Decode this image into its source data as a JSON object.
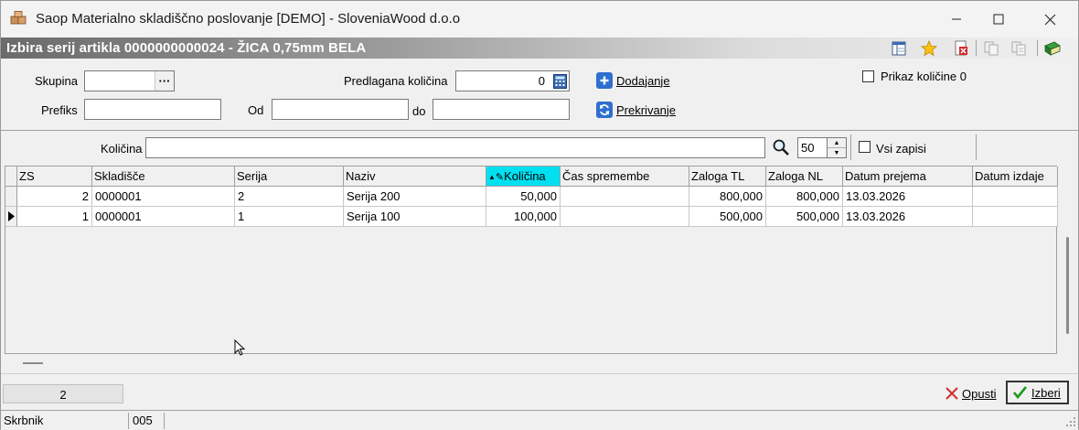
{
  "window": {
    "title": "Saop Materialno skladiščno poslovanje [DEMO] - SloveniaWood d.o.o"
  },
  "header": {
    "title": "Izbira serij artikla 0000000000024 - ŽICA 0,75mm BELA"
  },
  "filters": {
    "skupina_label": "Skupina",
    "skupina_value": "",
    "dots_label": "···",
    "prefiks_label": "Prefiks",
    "prefiks_value": "",
    "od_label": "Od",
    "od_value": "",
    "do_label": "do",
    "do_value": "",
    "predlagana_label": "Predlagana količina",
    "predlagana_value": "0",
    "dodajanje_label": "Dodajanje",
    "prekrivanje_label": "Prekrivanje",
    "prikaz_label": "Prikaz količine 0",
    "prikaz_checked": false,
    "kolicina_label": "Količina",
    "kolicina_value": "",
    "limit_value": "50",
    "vsi_label": "Vsi zapisi",
    "vsi_checked": false
  },
  "grid": {
    "columns": [
      "ZS",
      "Skladišče",
      "Serija",
      "Naziv",
      "Količina",
      "Čas spremembe",
      "Zaloga TL",
      "Zaloga NL",
      "Datum prejema",
      "Datum izdaje"
    ],
    "sorted_column": "Količina",
    "rows": [
      {
        "zs": "2",
        "skladisce": "0000001",
        "serija": "2",
        "naziv": "Serija 200",
        "kolicina": "50,000",
        "cas": "",
        "zaloga_tl": "800,000",
        "zaloga_nl": "800,000",
        "datum_prejema": "13.03.2026",
        "datum_izdaje": "",
        "current": false
      },
      {
        "zs": "1",
        "skladisce": "0000001",
        "serija": "1",
        "naziv": "Serija 100",
        "kolicina": "100,000",
        "cas": "",
        "zaloga_tl": "500,000",
        "zaloga_nl": "500,000",
        "datum_prejema": "13.03.2026",
        "datum_izdaje": "",
        "current": true
      }
    ]
  },
  "footer": {
    "count": "2",
    "opusti_label": "Opusti",
    "izberi_label": "Izberi"
  },
  "statusbar": {
    "user": "Skrbnik",
    "code": "005",
    "extra": ""
  },
  "colors": {
    "sorted_header": "#00e0f0",
    "action_icon": "#2f6fcf",
    "cancel_x": "#d03030",
    "ok_check": "#1e9a1e"
  }
}
